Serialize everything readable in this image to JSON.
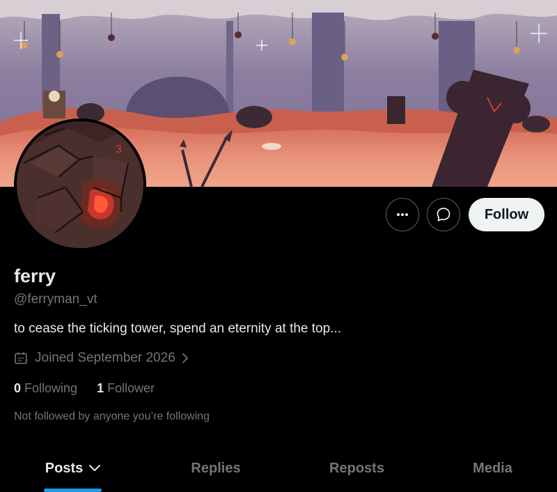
{
  "profile": {
    "name": "ferry",
    "handle": "@ferryman_vt",
    "bio": "to cease the ticking tower, spend an eternity at the top...",
    "joined": "Joined September 2026",
    "following_count": "0",
    "following_label": "Following",
    "followers_count": "1",
    "followers_label": "Follower",
    "not_followed_text": "Not followed by anyone you’re following"
  },
  "actions": {
    "more_icon": "more-icon",
    "message_icon": "message-icon",
    "follow_label": "Follow"
  },
  "tabs": [
    {
      "label": "Posts",
      "active": true
    },
    {
      "label": "Replies",
      "active": false
    },
    {
      "label": "Reposts",
      "active": false
    },
    {
      "label": "Media",
      "active": false
    }
  ],
  "colors": {
    "accent": "#1d9bf0",
    "background": "#000000",
    "secondary_text": "#71767b",
    "primary_text": "#e7e9ea"
  }
}
